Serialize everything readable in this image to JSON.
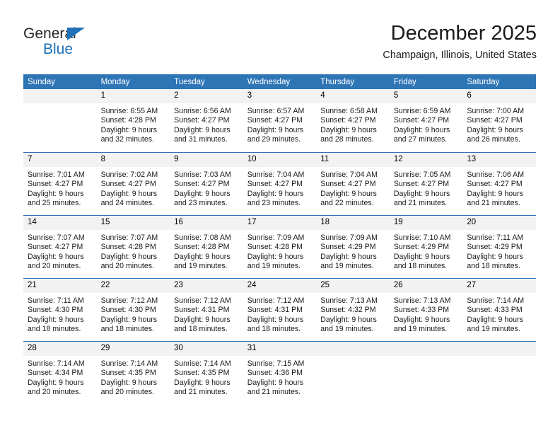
{
  "logo": {
    "name_part1": "General",
    "name_part2": "Blue",
    "triangle_color": "#1F72B8"
  },
  "header": {
    "month_title": "December 2025",
    "location": "Champaign, Illinois, United States"
  },
  "theme": {
    "header_blue": "#2E75B6",
    "daynum_background": "#F2F2F2",
    "text": "#1a1a1a"
  },
  "weekday_headers": [
    "Sunday",
    "Monday",
    "Tuesday",
    "Wednesday",
    "Thursday",
    "Friday",
    "Saturday"
  ],
  "weeks": [
    [
      {
        "day": "",
        "sunrise": "",
        "sunset": "",
        "daylight_line1": "",
        "daylight_line2": "",
        "blank": true
      },
      {
        "day": "1",
        "sunrise": "Sunrise: 6:55 AM",
        "sunset": "Sunset: 4:28 PM",
        "daylight_line1": "Daylight: 9 hours",
        "daylight_line2": "and 32 minutes."
      },
      {
        "day": "2",
        "sunrise": "Sunrise: 6:56 AM",
        "sunset": "Sunset: 4:27 PM",
        "daylight_line1": "Daylight: 9 hours",
        "daylight_line2": "and 31 minutes."
      },
      {
        "day": "3",
        "sunrise": "Sunrise: 6:57 AM",
        "sunset": "Sunset: 4:27 PM",
        "daylight_line1": "Daylight: 9 hours",
        "daylight_line2": "and 29 minutes."
      },
      {
        "day": "4",
        "sunrise": "Sunrise: 6:58 AM",
        "sunset": "Sunset: 4:27 PM",
        "daylight_line1": "Daylight: 9 hours",
        "daylight_line2": "and 28 minutes."
      },
      {
        "day": "5",
        "sunrise": "Sunrise: 6:59 AM",
        "sunset": "Sunset: 4:27 PM",
        "daylight_line1": "Daylight: 9 hours",
        "daylight_line2": "and 27 minutes."
      },
      {
        "day": "6",
        "sunrise": "Sunrise: 7:00 AM",
        "sunset": "Sunset: 4:27 PM",
        "daylight_line1": "Daylight: 9 hours",
        "daylight_line2": "and 26 minutes."
      }
    ],
    [
      {
        "day": "7",
        "sunrise": "Sunrise: 7:01 AM",
        "sunset": "Sunset: 4:27 PM",
        "daylight_line1": "Daylight: 9 hours",
        "daylight_line2": "and 25 minutes."
      },
      {
        "day": "8",
        "sunrise": "Sunrise: 7:02 AM",
        "sunset": "Sunset: 4:27 PM",
        "daylight_line1": "Daylight: 9 hours",
        "daylight_line2": "and 24 minutes."
      },
      {
        "day": "9",
        "sunrise": "Sunrise: 7:03 AM",
        "sunset": "Sunset: 4:27 PM",
        "daylight_line1": "Daylight: 9 hours",
        "daylight_line2": "and 23 minutes."
      },
      {
        "day": "10",
        "sunrise": "Sunrise: 7:04 AM",
        "sunset": "Sunset: 4:27 PM",
        "daylight_line1": "Daylight: 9 hours",
        "daylight_line2": "and 23 minutes."
      },
      {
        "day": "11",
        "sunrise": "Sunrise: 7:04 AM",
        "sunset": "Sunset: 4:27 PM",
        "daylight_line1": "Daylight: 9 hours",
        "daylight_line2": "and 22 minutes."
      },
      {
        "day": "12",
        "sunrise": "Sunrise: 7:05 AM",
        "sunset": "Sunset: 4:27 PM",
        "daylight_line1": "Daylight: 9 hours",
        "daylight_line2": "and 21 minutes."
      },
      {
        "day": "13",
        "sunrise": "Sunrise: 7:06 AM",
        "sunset": "Sunset: 4:27 PM",
        "daylight_line1": "Daylight: 9 hours",
        "daylight_line2": "and 21 minutes."
      }
    ],
    [
      {
        "day": "14",
        "sunrise": "Sunrise: 7:07 AM",
        "sunset": "Sunset: 4:27 PM",
        "daylight_line1": "Daylight: 9 hours",
        "daylight_line2": "and 20 minutes."
      },
      {
        "day": "15",
        "sunrise": "Sunrise: 7:07 AM",
        "sunset": "Sunset: 4:28 PM",
        "daylight_line1": "Daylight: 9 hours",
        "daylight_line2": "and 20 minutes."
      },
      {
        "day": "16",
        "sunrise": "Sunrise: 7:08 AM",
        "sunset": "Sunset: 4:28 PM",
        "daylight_line1": "Daylight: 9 hours",
        "daylight_line2": "and 19 minutes."
      },
      {
        "day": "17",
        "sunrise": "Sunrise: 7:09 AM",
        "sunset": "Sunset: 4:28 PM",
        "daylight_line1": "Daylight: 9 hours",
        "daylight_line2": "and 19 minutes."
      },
      {
        "day": "18",
        "sunrise": "Sunrise: 7:09 AM",
        "sunset": "Sunset: 4:29 PM",
        "daylight_line1": "Daylight: 9 hours",
        "daylight_line2": "and 19 minutes."
      },
      {
        "day": "19",
        "sunrise": "Sunrise: 7:10 AM",
        "sunset": "Sunset: 4:29 PM",
        "daylight_line1": "Daylight: 9 hours",
        "daylight_line2": "and 18 minutes."
      },
      {
        "day": "20",
        "sunrise": "Sunrise: 7:11 AM",
        "sunset": "Sunset: 4:29 PM",
        "daylight_line1": "Daylight: 9 hours",
        "daylight_line2": "and 18 minutes."
      }
    ],
    [
      {
        "day": "21",
        "sunrise": "Sunrise: 7:11 AM",
        "sunset": "Sunset: 4:30 PM",
        "daylight_line1": "Daylight: 9 hours",
        "daylight_line2": "and 18 minutes."
      },
      {
        "day": "22",
        "sunrise": "Sunrise: 7:12 AM",
        "sunset": "Sunset: 4:30 PM",
        "daylight_line1": "Daylight: 9 hours",
        "daylight_line2": "and 18 minutes."
      },
      {
        "day": "23",
        "sunrise": "Sunrise: 7:12 AM",
        "sunset": "Sunset: 4:31 PM",
        "daylight_line1": "Daylight: 9 hours",
        "daylight_line2": "and 18 minutes."
      },
      {
        "day": "24",
        "sunrise": "Sunrise: 7:12 AM",
        "sunset": "Sunset: 4:31 PM",
        "daylight_line1": "Daylight: 9 hours",
        "daylight_line2": "and 18 minutes."
      },
      {
        "day": "25",
        "sunrise": "Sunrise: 7:13 AM",
        "sunset": "Sunset: 4:32 PM",
        "daylight_line1": "Daylight: 9 hours",
        "daylight_line2": "and 19 minutes."
      },
      {
        "day": "26",
        "sunrise": "Sunrise: 7:13 AM",
        "sunset": "Sunset: 4:33 PM",
        "daylight_line1": "Daylight: 9 hours",
        "daylight_line2": "and 19 minutes."
      },
      {
        "day": "27",
        "sunrise": "Sunrise: 7:14 AM",
        "sunset": "Sunset: 4:33 PM",
        "daylight_line1": "Daylight: 9 hours",
        "daylight_line2": "and 19 minutes."
      }
    ],
    [
      {
        "day": "28",
        "sunrise": "Sunrise: 7:14 AM",
        "sunset": "Sunset: 4:34 PM",
        "daylight_line1": "Daylight: 9 hours",
        "daylight_line2": "and 20 minutes."
      },
      {
        "day": "29",
        "sunrise": "Sunrise: 7:14 AM",
        "sunset": "Sunset: 4:35 PM",
        "daylight_line1": "Daylight: 9 hours",
        "daylight_line2": "and 20 minutes."
      },
      {
        "day": "30",
        "sunrise": "Sunrise: 7:14 AM",
        "sunset": "Sunset: 4:35 PM",
        "daylight_line1": "Daylight: 9 hours",
        "daylight_line2": "and 21 minutes."
      },
      {
        "day": "31",
        "sunrise": "Sunrise: 7:15 AM",
        "sunset": "Sunset: 4:36 PM",
        "daylight_line1": "Daylight: 9 hours",
        "daylight_line2": "and 21 minutes."
      },
      {
        "day": "",
        "sunrise": "",
        "sunset": "",
        "daylight_line1": "",
        "daylight_line2": "",
        "blank": true
      },
      {
        "day": "",
        "sunrise": "",
        "sunset": "",
        "daylight_line1": "",
        "daylight_line2": "",
        "blank": true
      },
      {
        "day": "",
        "sunrise": "",
        "sunset": "",
        "daylight_line1": "",
        "daylight_line2": "",
        "blank": true
      }
    ]
  ]
}
